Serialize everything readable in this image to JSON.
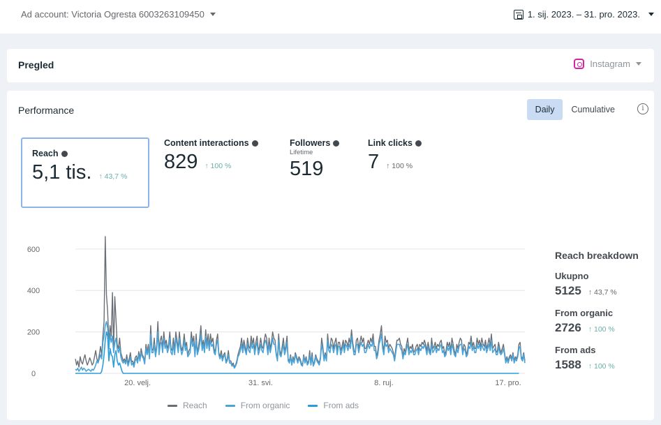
{
  "header": {
    "account_label": "Ad account: Victoria Ogresta 6003263109450",
    "date_range": "1. sij. 2023. – 31. pro. 2023."
  },
  "overview": {
    "title": "Pregled",
    "platform": "Instagram"
  },
  "performance": {
    "title": "Performance",
    "toggle": {
      "daily": "Daily",
      "cumulative": "Cumulative"
    },
    "info_icon": "i"
  },
  "metrics": [
    {
      "label": "Reach",
      "sub": "",
      "value": "5,1 tis.",
      "delta": "↑ 43,7 %"
    },
    {
      "label": "Content interactions",
      "sub": "",
      "value": "829",
      "delta": "↑ 100 %"
    },
    {
      "label": "Followers",
      "sub": "Lifetime",
      "value": "519",
      "delta": ""
    },
    {
      "label": "Link clicks",
      "sub": "",
      "value": "7",
      "delta": "↑ 100 %"
    }
  ],
  "breakdown": {
    "title": "Reach breakdown",
    "items": [
      {
        "label": "Ukupno",
        "value": "5125",
        "delta": "↑ 43,7 %"
      },
      {
        "label": "From organic",
        "value": "2726",
        "delta": "↑ 100 %"
      },
      {
        "label": "From ads",
        "value": "1588",
        "delta": "↑ 100 %"
      }
    ]
  },
  "legend": {
    "reach": "Reach",
    "organic": "From organic",
    "ads": "From ads"
  },
  "colors": {
    "reach": "#6a6f75",
    "organic": "#4aa3d9",
    "ads": "#2d9cdb",
    "selected_border": "#8cb4e8"
  },
  "chart_data": {
    "type": "line",
    "x_ticks": [
      "20. velj.",
      "31. svi.",
      "8. ruj.",
      "17. pro."
    ],
    "y_ticks": [
      0,
      200,
      400,
      600
    ],
    "ylim": [
      0,
      650
    ],
    "x_days": 365,
    "series": [
      {
        "name": "Reach",
        "values": [
          70,
          40,
          60,
          30,
          80,
          55,
          45,
          70,
          90,
          60,
          40,
          55,
          75,
          60,
          40,
          50,
          80,
          110,
          70,
          55,
          90,
          130,
          85,
          180,
          250,
          660,
          380,
          300,
          150,
          230,
          180,
          390,
          120,
          370,
          260,
          140,
          120,
          170,
          100,
          80,
          60,
          70,
          55,
          90,
          45,
          70,
          100,
          55,
          60,
          40,
          75,
          85,
          60,
          105,
          70,
          120,
          90,
          80,
          55,
          140,
          100,
          140,
          80,
          230,
          120,
          110,
          170,
          90,
          140,
          250,
          110,
          160,
          180,
          120,
          200,
          140,
          160,
          120,
          140,
          200,
          120,
          110,
          170,
          110,
          200,
          160,
          120,
          200,
          140,
          110,
          130,
          190,
          130,
          150,
          90,
          110,
          120,
          200,
          150,
          180,
          90,
          190,
          100,
          130,
          170,
          230,
          130,
          160,
          120,
          210,
          140,
          190,
          130,
          190,
          150,
          170,
          120,
          100,
          160,
          190,
          100,
          80,
          110,
          70,
          90,
          100,
          60,
          70,
          110,
          60,
          60,
          40,
          50,
          30,
          40,
          60,
          90,
          110,
          130,
          170,
          120,
          160,
          130,
          100,
          170,
          130,
          120,
          180,
          140,
          170,
          110,
          150,
          180,
          110,
          130,
          170,
          130,
          120,
          160,
          190,
          170,
          100,
          170,
          120,
          150,
          200,
          170,
          160,
          100,
          70,
          190,
          110,
          90,
          130,
          170,
          110,
          130,
          180,
          70,
          60,
          90,
          50,
          80,
          60,
          100,
          80,
          60,
          80,
          70,
          50,
          40,
          90,
          60,
          80,
          50,
          60,
          110,
          50,
          100,
          40,
          60,
          90,
          70,
          60,
          50,
          80,
          170,
          130,
          70,
          100,
          70,
          190,
          130,
          120,
          170,
          160,
          120,
          150,
          170,
          110,
          150,
          150,
          110,
          130,
          160,
          120,
          160,
          150,
          130,
          170,
          140,
          210,
          150,
          110,
          100,
          160,
          170,
          120,
          150,
          180,
          150,
          170,
          120,
          120,
          140,
          160,
          140,
          170,
          150,
          190,
          130,
          130,
          80,
          110,
          160,
          190,
          230,
          140,
          110,
          180,
          150,
          160,
          120,
          140,
          130,
          120,
          100,
          70,
          120,
          160,
          160,
          170,
          140,
          130,
          80,
          120,
          100,
          140,
          170,
          110,
          130,
          120,
          140,
          100,
          110,
          130,
          140,
          110,
          140,
          130,
          150,
          140,
          160,
          140,
          110,
          150,
          120,
          100,
          170,
          120,
          130,
          150,
          120,
          140,
          130,
          150,
          160,
          120,
          130,
          90,
          110,
          150,
          130,
          150,
          110,
          170,
          140,
          110,
          90,
          140,
          120,
          150,
          170,
          160,
          100,
          140,
          130,
          90,
          110,
          150,
          140,
          180,
          130,
          150,
          120,
          120,
          170,
          140,
          160,
          130,
          170,
          140,
          130,
          160,
          120,
          140,
          170,
          130,
          190,
          120,
          130,
          140,
          100,
          110,
          150,
          120,
          100,
          120,
          140,
          100,
          60,
          80,
          60,
          80,
          90,
          70,
          100,
          60,
          80,
          70,
          90,
          140,
          150,
          80,
          70,
          100,
          60
        ]
      },
      {
        "name": "From organic",
        "values": [
          20,
          15,
          25,
          10,
          20,
          30,
          15,
          25,
          20,
          10,
          15,
          20,
          15,
          10,
          20,
          15,
          25,
          40,
          60,
          50,
          70,
          90,
          70,
          150,
          180,
          230,
          250,
          220,
          120,
          190,
          150,
          180,
          100,
          150,
          170,
          120,
          100,
          130,
          80,
          60,
          50,
          60,
          45,
          70,
          35,
          55,
          80,
          40,
          50,
          30,
          60,
          70,
          50,
          90,
          60,
          100,
          80,
          70,
          45,
          120,
          90,
          120,
          70,
          190,
          100,
          100,
          140,
          80,
          120,
          200,
          90,
          140,
          150,
          100,
          170,
          120,
          140,
          100,
          120,
          170,
          100,
          90,
          140,
          90,
          170,
          140,
          100,
          170,
          120,
          90,
          110,
          160,
          110,
          130,
          80,
          90,
          100,
          170,
          130,
          150,
          80,
          160,
          90,
          110,
          140,
          190,
          110,
          140,
          100,
          180,
          120,
          160,
          110,
          160,
          130,
          140,
          100,
          90,
          140,
          160,
          90,
          70,
          90,
          60,
          80,
          90,
          50,
          60,
          90,
          50,
          50,
          35,
          40,
          25,
          35,
          50,
          80,
          90,
          110,
          140,
          100,
          140,
          110,
          90,
          140,
          110,
          100,
          150,
          120,
          140,
          90,
          130,
          150,
          90,
          110,
          140,
          110,
          100,
          140,
          160,
          140,
          90,
          140,
          100,
          130,
          170,
          140,
          140,
          90,
          60,
          160,
          90,
          80,
          110,
          140,
          90,
          110,
          150,
          60,
          50,
          80,
          40,
          70,
          50,
          90,
          70,
          50,
          70,
          60,
          40,
          35,
          80,
          50,
          70,
          40,
          50,
          90,
          40,
          80,
          35,
          50,
          80,
          60,
          50,
          40,
          70,
          140,
          110,
          60,
          90,
          60,
          160,
          110,
          100,
          140,
          130,
          100,
          130,
          140,
          90,
          130,
          130,
          90,
          110,
          140,
          100,
          140,
          130,
          110,
          140,
          120,
          180,
          130,
          90,
          90,
          140,
          140,
          100,
          130,
          150,
          130,
          140,
          100,
          100,
          120,
          140,
          120,
          140,
          130,
          160,
          110,
          110,
          70,
          90,
          140,
          160,
          190,
          120,
          90,
          150,
          130,
          140,
          100,
          120,
          110,
          100,
          90,
          60,
          100,
          140,
          140,
          140,
          120,
          110,
          70,
          100,
          90,
          120,
          140,
          90,
          110,
          100,
          120,
          90,
          90,
          110,
          120,
          90,
          120,
          110,
          130,
          120,
          140,
          120,
          90,
          130,
          100,
          90,
          140,
          100,
          110,
          130,
          100,
          120,
          110,
          130,
          140,
          100,
          110,
          80,
          90,
          130,
          110,
          130,
          90,
          140,
          120,
          90,
          80,
          120,
          100,
          130,
          140,
          140,
          90,
          120,
          110,
          80,
          90,
          130,
          120,
          150,
          110,
          130,
          100,
          100,
          140,
          120,
          140,
          110,
          140,
          120,
          110,
          140,
          100,
          120,
          140,
          110,
          160,
          100,
          110,
          120,
          90,
          90,
          130,
          100,
          90,
          100,
          120,
          90,
          50,
          70,
          50,
          70,
          80,
          60,
          90,
          50,
          70,
          60,
          80,
          120,
          130,
          70,
          60,
          90,
          50
        ]
      },
      {
        "name": "From ads",
        "values": [
          0,
          0,
          0,
          0,
          0,
          0,
          0,
          0,
          0,
          0,
          0,
          0,
          0,
          0,
          0,
          0,
          0,
          0,
          0,
          0,
          0,
          0,
          10,
          40,
          90,
          160,
          200,
          180,
          60,
          120,
          90,
          80,
          30,
          90,
          110,
          60,
          40,
          50,
          30,
          10,
          0,
          0,
          0,
          0,
          0,
          0,
          0,
          0,
          0,
          0,
          0,
          0,
          0,
          0,
          0,
          0,
          0,
          0,
          0,
          0,
          0,
          0,
          0,
          0,
          0,
          0,
          0,
          0,
          0,
          0,
          0,
          0,
          0,
          0,
          0,
          0,
          0,
          0,
          0,
          0,
          0,
          0,
          0,
          0,
          0,
          0,
          0,
          0,
          0,
          0,
          0,
          0,
          0,
          0,
          0,
          0,
          0,
          0,
          0,
          0,
          0,
          0,
          0,
          0,
          0,
          0,
          0,
          0,
          0,
          0,
          0,
          0,
          0,
          0,
          0,
          0,
          0,
          0,
          0,
          0,
          0,
          0,
          0,
          0,
          0,
          0,
          0,
          0,
          0,
          0,
          0,
          0,
          0,
          0,
          0,
          0,
          0,
          0,
          0,
          0,
          0,
          0,
          0,
          0,
          0,
          0,
          0,
          0,
          0,
          0,
          0,
          0,
          0,
          0,
          0,
          0,
          0,
          0,
          0,
          0,
          0,
          0,
          0,
          0,
          0,
          0,
          0,
          0,
          0,
          0,
          0,
          0,
          0,
          0,
          0,
          0,
          0,
          0,
          0,
          0,
          0,
          0,
          0,
          0,
          0,
          0,
          0,
          0,
          0,
          0,
          0,
          0,
          0,
          0,
          0,
          0,
          0,
          0,
          0,
          0,
          0,
          0,
          0,
          0,
          0,
          0,
          0,
          0,
          0,
          0,
          0,
          0,
          0,
          0,
          0,
          0,
          0,
          0,
          0,
          0,
          0,
          0,
          0,
          0,
          0,
          0,
          0,
          0,
          0,
          0,
          0,
          0,
          0,
          0,
          0,
          0,
          0,
          0,
          0,
          0,
          0,
          0,
          0,
          0,
          0,
          0,
          0,
          0,
          0,
          0,
          0,
          0,
          0,
          0,
          0,
          0,
          0,
          0,
          0,
          0,
          0,
          0,
          0,
          0,
          0,
          0,
          0,
          0,
          0,
          0,
          0,
          0,
          0,
          0,
          0,
          0,
          0,
          0,
          0,
          0,
          0,
          0,
          0,
          0,
          0,
          0,
          0,
          0,
          0,
          0,
          0,
          0,
          0,
          0,
          0,
          0,
          0,
          0,
          0,
          0,
          0,
          0,
          0,
          0,
          0,
          0,
          0,
          0,
          0,
          0,
          0,
          0,
          0,
          0,
          0,
          0,
          0,
          0,
          0,
          0,
          0,
          0,
          0,
          0,
          0,
          0,
          0,
          0,
          0,
          0,
          0,
          0,
          0,
          0,
          0,
          0,
          0,
          0,
          0,
          0,
          0,
          0,
          0,
          0,
          0,
          0,
          0,
          0,
          0,
          0,
          0,
          0,
          0,
          0,
          0,
          0,
          0,
          0,
          0,
          0,
          0,
          0,
          0,
          0,
          0,
          0,
          0,
          0,
          0,
          0,
          0,
          0
        ]
      }
    ]
  }
}
